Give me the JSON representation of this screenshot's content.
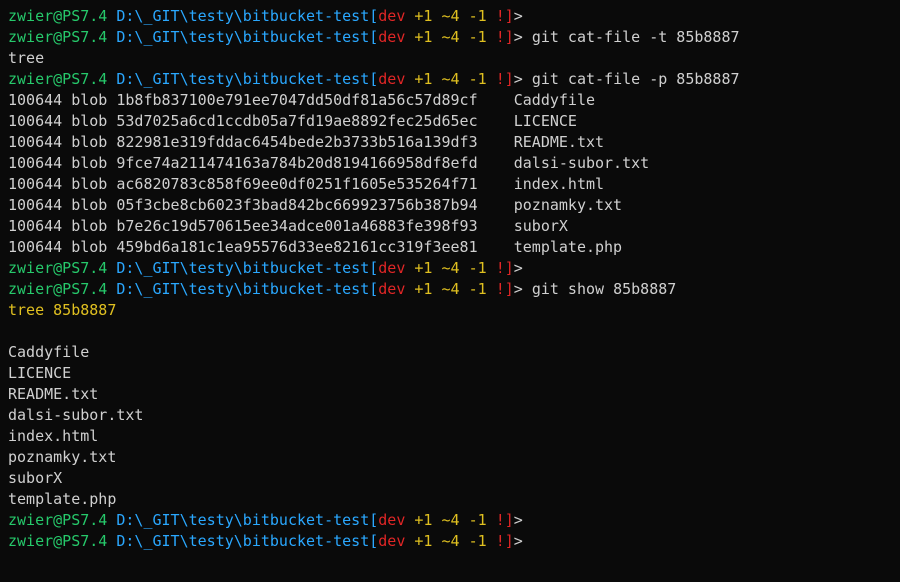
{
  "prompt": {
    "user": "zwier@PS7.4",
    "path": "D:\\_GIT\\testy\\bitbucket-test",
    "branch": "dev",
    "stats_lead": " +1 ~4 -1 ",
    "stats_mark": "!",
    "close_bracket": "]",
    "angle": ">"
  },
  "commands": {
    "cat_file_t": "git cat-file -t 85b8887",
    "cat_file_p": "git cat-file -p 85b8887",
    "show": "git show 85b8887"
  },
  "out": {
    "tree_word": "tree",
    "show_header_prefix": "tree ",
    "show_header_hash": "85b8887",
    "tree_entries": [
      {
        "mode": "100644",
        "type": "blob",
        "sha": "1b8fb837100e791ee7047dd50df81a56c57d89cf",
        "name": "Caddyfile"
      },
      {
        "mode": "100644",
        "type": "blob",
        "sha": "53d7025a6cd1ccdb05a7fd19ae8892fec25d65ec",
        "name": "LICENCE"
      },
      {
        "mode": "100644",
        "type": "blob",
        "sha": "822981e319fddac6454bede2b3733b516a139df3",
        "name": "README.txt"
      },
      {
        "mode": "100644",
        "type": "blob",
        "sha": "9fce74a211474163a784b20d8194166958df8efd",
        "name": "dalsi-subor.txt"
      },
      {
        "mode": "100644",
        "type": "blob",
        "sha": "ac6820783c858f69ee0df0251f1605e535264f71",
        "name": "index.html"
      },
      {
        "mode": "100644",
        "type": "blob",
        "sha": "05f3cbe8cb6023f3bad842bc669923756b387b94",
        "name": "poznamky.txt"
      },
      {
        "mode": "100644",
        "type": "blob",
        "sha": "b7e26c19d570615ee34adce001a46883fe398f93",
        "name": "suborX"
      },
      {
        "mode": "100644",
        "type": "blob",
        "sha": "459bd6a181c1ea95576d33ee82161cc319f3ee81",
        "name": "template.php"
      }
    ],
    "show_files": [
      "Caddyfile",
      "LICENCE",
      "README.txt",
      "dalsi-subor.txt",
      "index.html",
      "poznamky.txt",
      "suborX",
      "template.php"
    ]
  }
}
